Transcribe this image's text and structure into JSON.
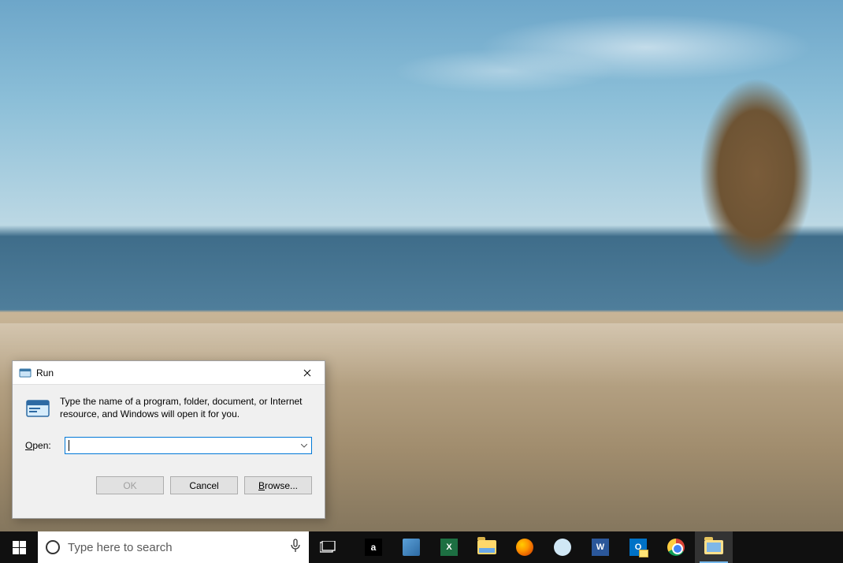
{
  "run_dialog": {
    "title": "Run",
    "description": "Type the name of a program, folder, document, or Internet resource, and Windows will open it for you.",
    "open_label_pre": "O",
    "open_label_post": "pen:",
    "input_value": "",
    "buttons": {
      "ok": "OK",
      "cancel": "Cancel",
      "browse_pre": "B",
      "browse_post": "rowse..."
    }
  },
  "taskbar": {
    "search_placeholder": "Type here to search",
    "apps": [
      {
        "name": "amazon",
        "glyph": "a"
      },
      {
        "name": "sticky-notes",
        "glyph": ""
      },
      {
        "name": "excel",
        "glyph": "X"
      },
      {
        "name": "file-explorer",
        "glyph": ""
      },
      {
        "name": "firefox",
        "glyph": ""
      },
      {
        "name": "skype",
        "glyph": ""
      },
      {
        "name": "word",
        "glyph": "W"
      },
      {
        "name": "outlook",
        "glyph": "O"
      },
      {
        "name": "chrome",
        "glyph": ""
      },
      {
        "name": "file-explorer-active",
        "glyph": ""
      }
    ]
  }
}
